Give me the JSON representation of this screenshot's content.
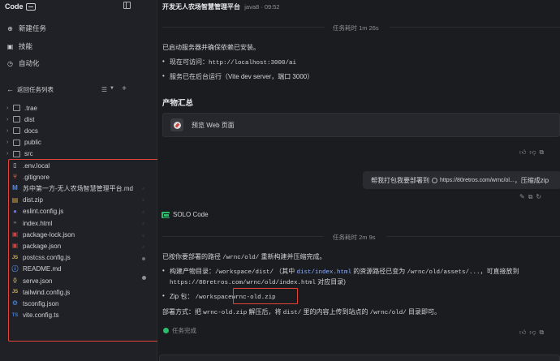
{
  "sidebar": {
    "brand": "Code",
    "nav": [
      {
        "label": "新建任务",
        "icon": "new-task-icon"
      },
      {
        "label": "技能",
        "icon": "skills-icon"
      },
      {
        "label": "自动化",
        "icon": "automation-icon"
      }
    ],
    "back_label": "返回任务列表",
    "folders": [
      ".trae",
      "dist",
      "docs",
      "public",
      "src"
    ],
    "files": [
      {
        "name": ".env.local",
        "icon": "file-icon",
        "color": "#c8c9cd",
        "glyph": "▯"
      },
      {
        "name": ".gitignore",
        "icon": "git-icon",
        "color": "#e0683d",
        "glyph": "⑂"
      },
      {
        "name": "苏中第一方-无人农场智慧管理平台.md",
        "icon": "markdown-icon",
        "color": "#5a8fd8",
        "glyph": "M"
      },
      {
        "name": "dist.zip",
        "icon": "zip-icon",
        "color": "#d9a53a",
        "glyph": "▤"
      },
      {
        "name": "eslint.config.js",
        "icon": "eslint-icon",
        "color": "#6b6fdf",
        "glyph": "●"
      },
      {
        "name": "index.html",
        "icon": "html-icon",
        "color": "#e07a3d",
        "glyph": "‹›"
      },
      {
        "name": "package-lock.json",
        "icon": "npm-icon",
        "color": "#d13f35",
        "glyph": "▣"
      },
      {
        "name": "package.json",
        "icon": "npm-icon",
        "color": "#d13f35",
        "glyph": "▣"
      },
      {
        "name": "postcss.config.js",
        "icon": "js-icon",
        "color": "#d9b13a",
        "glyph": "JS"
      },
      {
        "name": "README.md",
        "icon": "info-icon",
        "color": "#5a8fd8",
        "glyph": "ⓘ"
      },
      {
        "name": "serve.json",
        "icon": "json-icon",
        "color": "#d9b13a",
        "glyph": "{}"
      },
      {
        "name": "tailwind.config.js",
        "icon": "js-icon",
        "color": "#d9b13a",
        "glyph": "JS"
      },
      {
        "name": "tsconfig.json",
        "icon": "ts-config-icon",
        "color": "#5a8fd8",
        "glyph": "⚙"
      },
      {
        "name": "vite.config.ts",
        "icon": "ts-icon",
        "color": "#3b7bd8",
        "glyph": "TS"
      }
    ]
  },
  "main": {
    "title": "开发无人农场智慧管理平台",
    "subtitle": "java8 · 09:52",
    "divider1": "任务耗时 1m 26s",
    "p1": "已启动服务器并确保依赖已安装。",
    "b1_prefix": "现在可访问：",
    "b1_code": "http://localhost:3000/ai",
    "b2": "服务已在后台运行（Vite dev server，端口 3000）",
    "section_title": "产物汇总",
    "preview_label": "预览 Web 页面",
    "user_msg_prefix": "帮我打包我要部署到",
    "user_msg_url": "https://80retros.com/wrnc/ol...",
    "user_msg_suffix": "，压缩成zip",
    "solo_label": "SOLO Code",
    "divider2": "任务耗时 2m 9s",
    "p2_prefix": "已按你要部署的路径",
    "p2_code": "/wrnc/old/",
    "p2_suffix": "重新构建并压缩完成。",
    "b3_prefix": "构建产物目录：",
    "b3_code1": "/workspace/dist/",
    "b3_mid1": "（其中",
    "b3_link": "dist/index.html",
    "b3_mid2": "的资源路径已变为",
    "b3_code2": "/wrnc/old/assets/...",
    "b3_suffix": "，可直接放到",
    "b3_line2_code": "https://80retros.com/wrnc/old/index.html",
    "b3_line2_suffix": "对应目录)",
    "b4_prefix": "Zip 包：",
    "b4_code1": "/workspace",
    "b4_code2": "wrnc-old.zip",
    "p3_a": "部署方式：把",
    "p3_code1": "wrnc-old.zip",
    "p3_b": "解压后，将",
    "p3_code2": "dist/",
    "p3_c": "里的内容上传到站点的",
    "p3_code3": "/wrnc/old/",
    "p3_d": "目录即可。",
    "done_label": "任务完成"
  }
}
